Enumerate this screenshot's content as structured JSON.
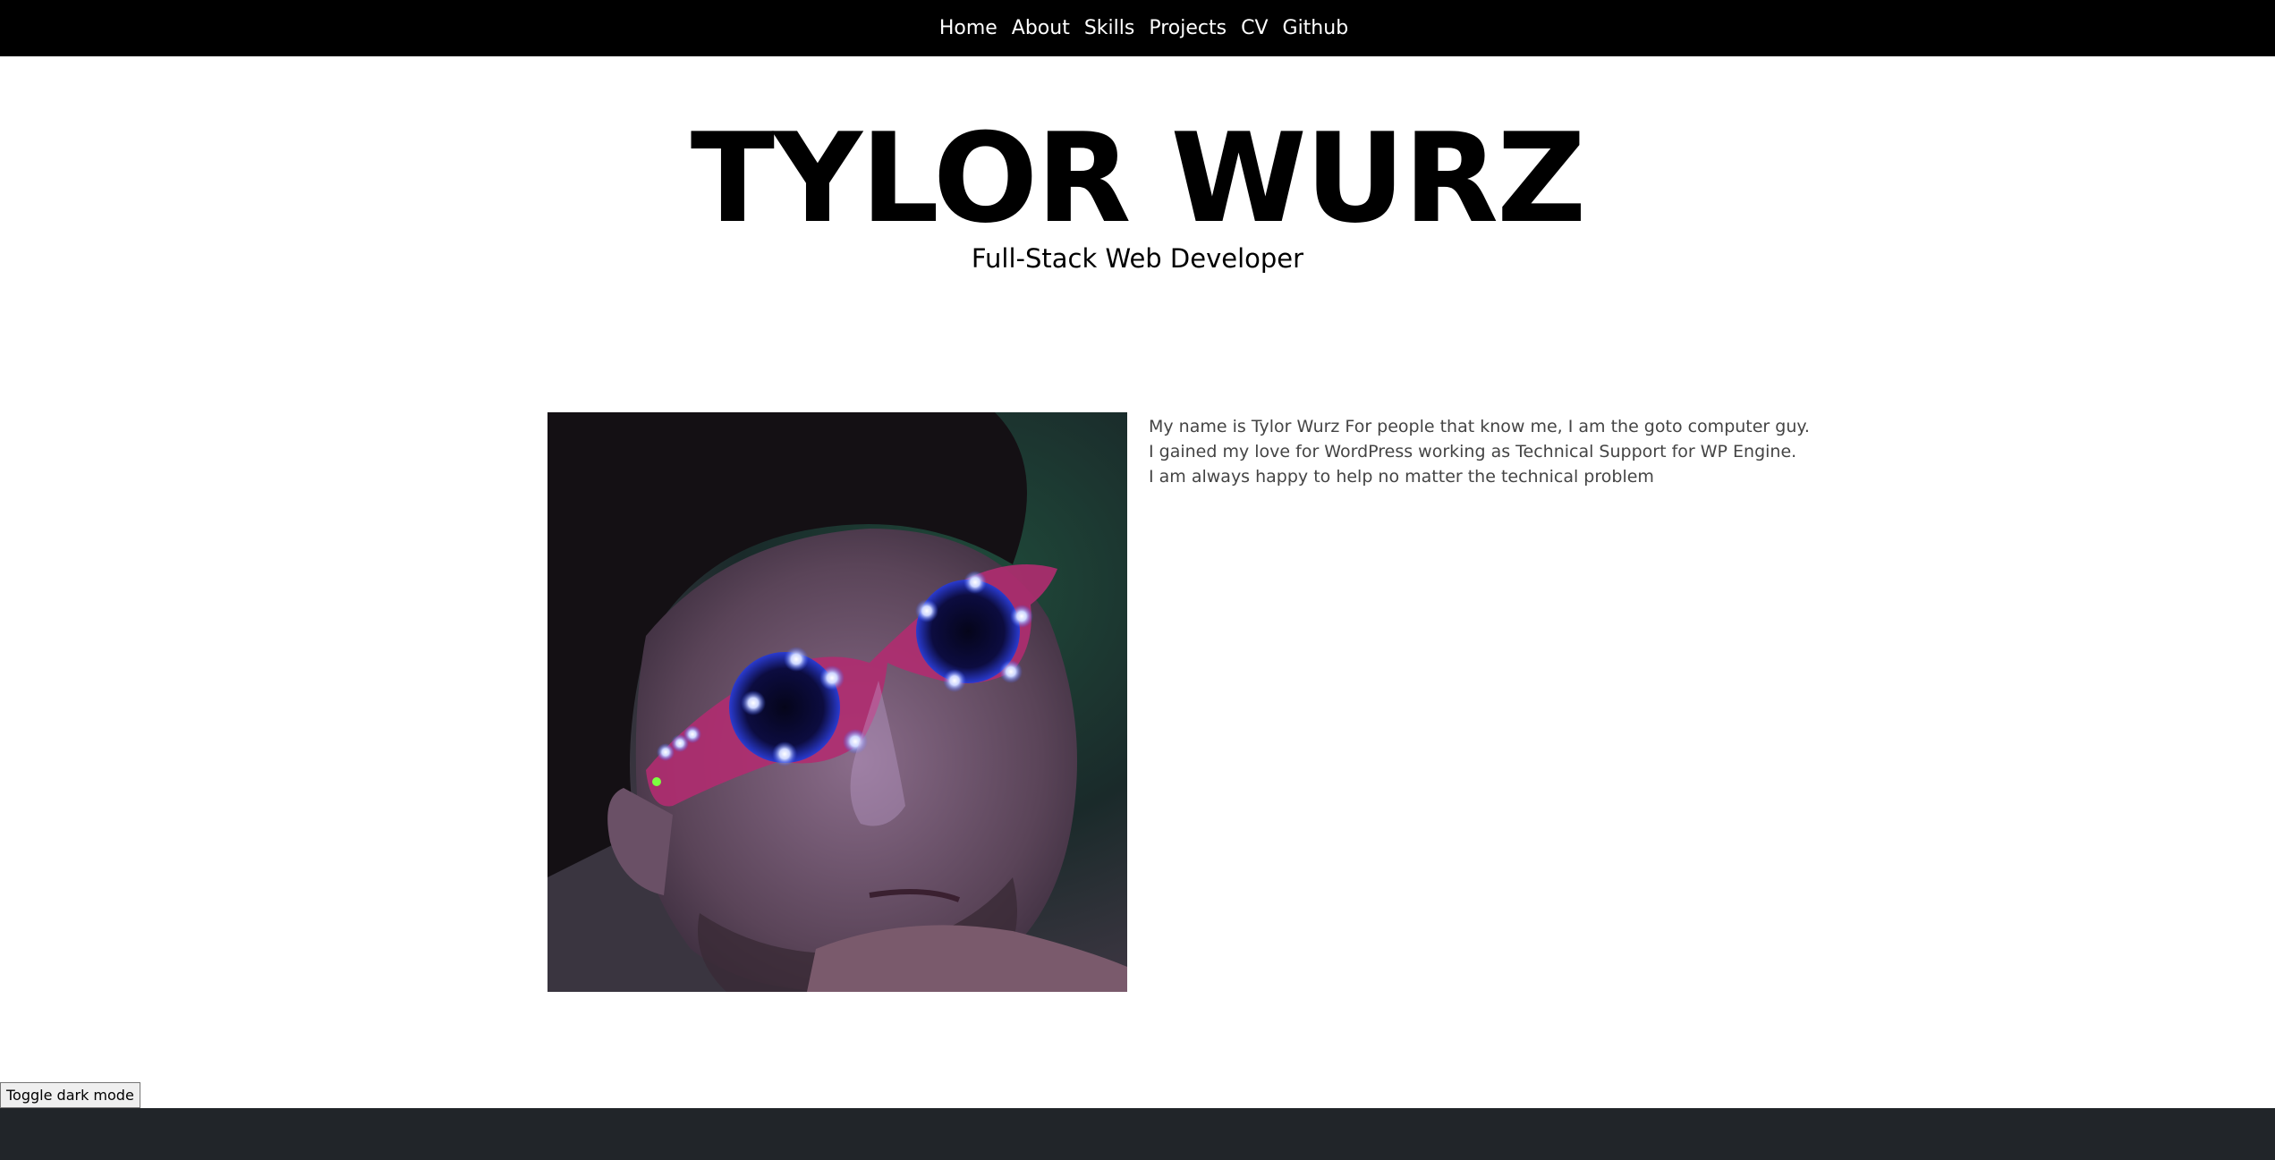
{
  "nav": {
    "items": [
      {
        "label": "Home"
      },
      {
        "label": "About"
      },
      {
        "label": "Skills"
      },
      {
        "label": "Projects"
      },
      {
        "label": "CV"
      },
      {
        "label": "Github"
      }
    ]
  },
  "hero": {
    "title": "TYLOR WURZ",
    "subtitle": "Full-Stack Web Developer"
  },
  "about": {
    "portrait_alt": "Portrait of a man wearing LED light-up glasses",
    "lines": [
      "My name is Tylor Wurz For people that know me, I am the goto computer guy.",
      "I gained my love for WordPress working as Technical Support for WP Engine.",
      "I am always happy to help no matter the technical problem"
    ]
  },
  "toggle": {
    "label": "Toggle dark mode"
  },
  "colors": {
    "navbar_bg": "#000000",
    "footer_bg": "#212529",
    "page_bg": "#ffffff",
    "led_blue": "#3b5bff",
    "frame_pink": "#c0307a"
  }
}
